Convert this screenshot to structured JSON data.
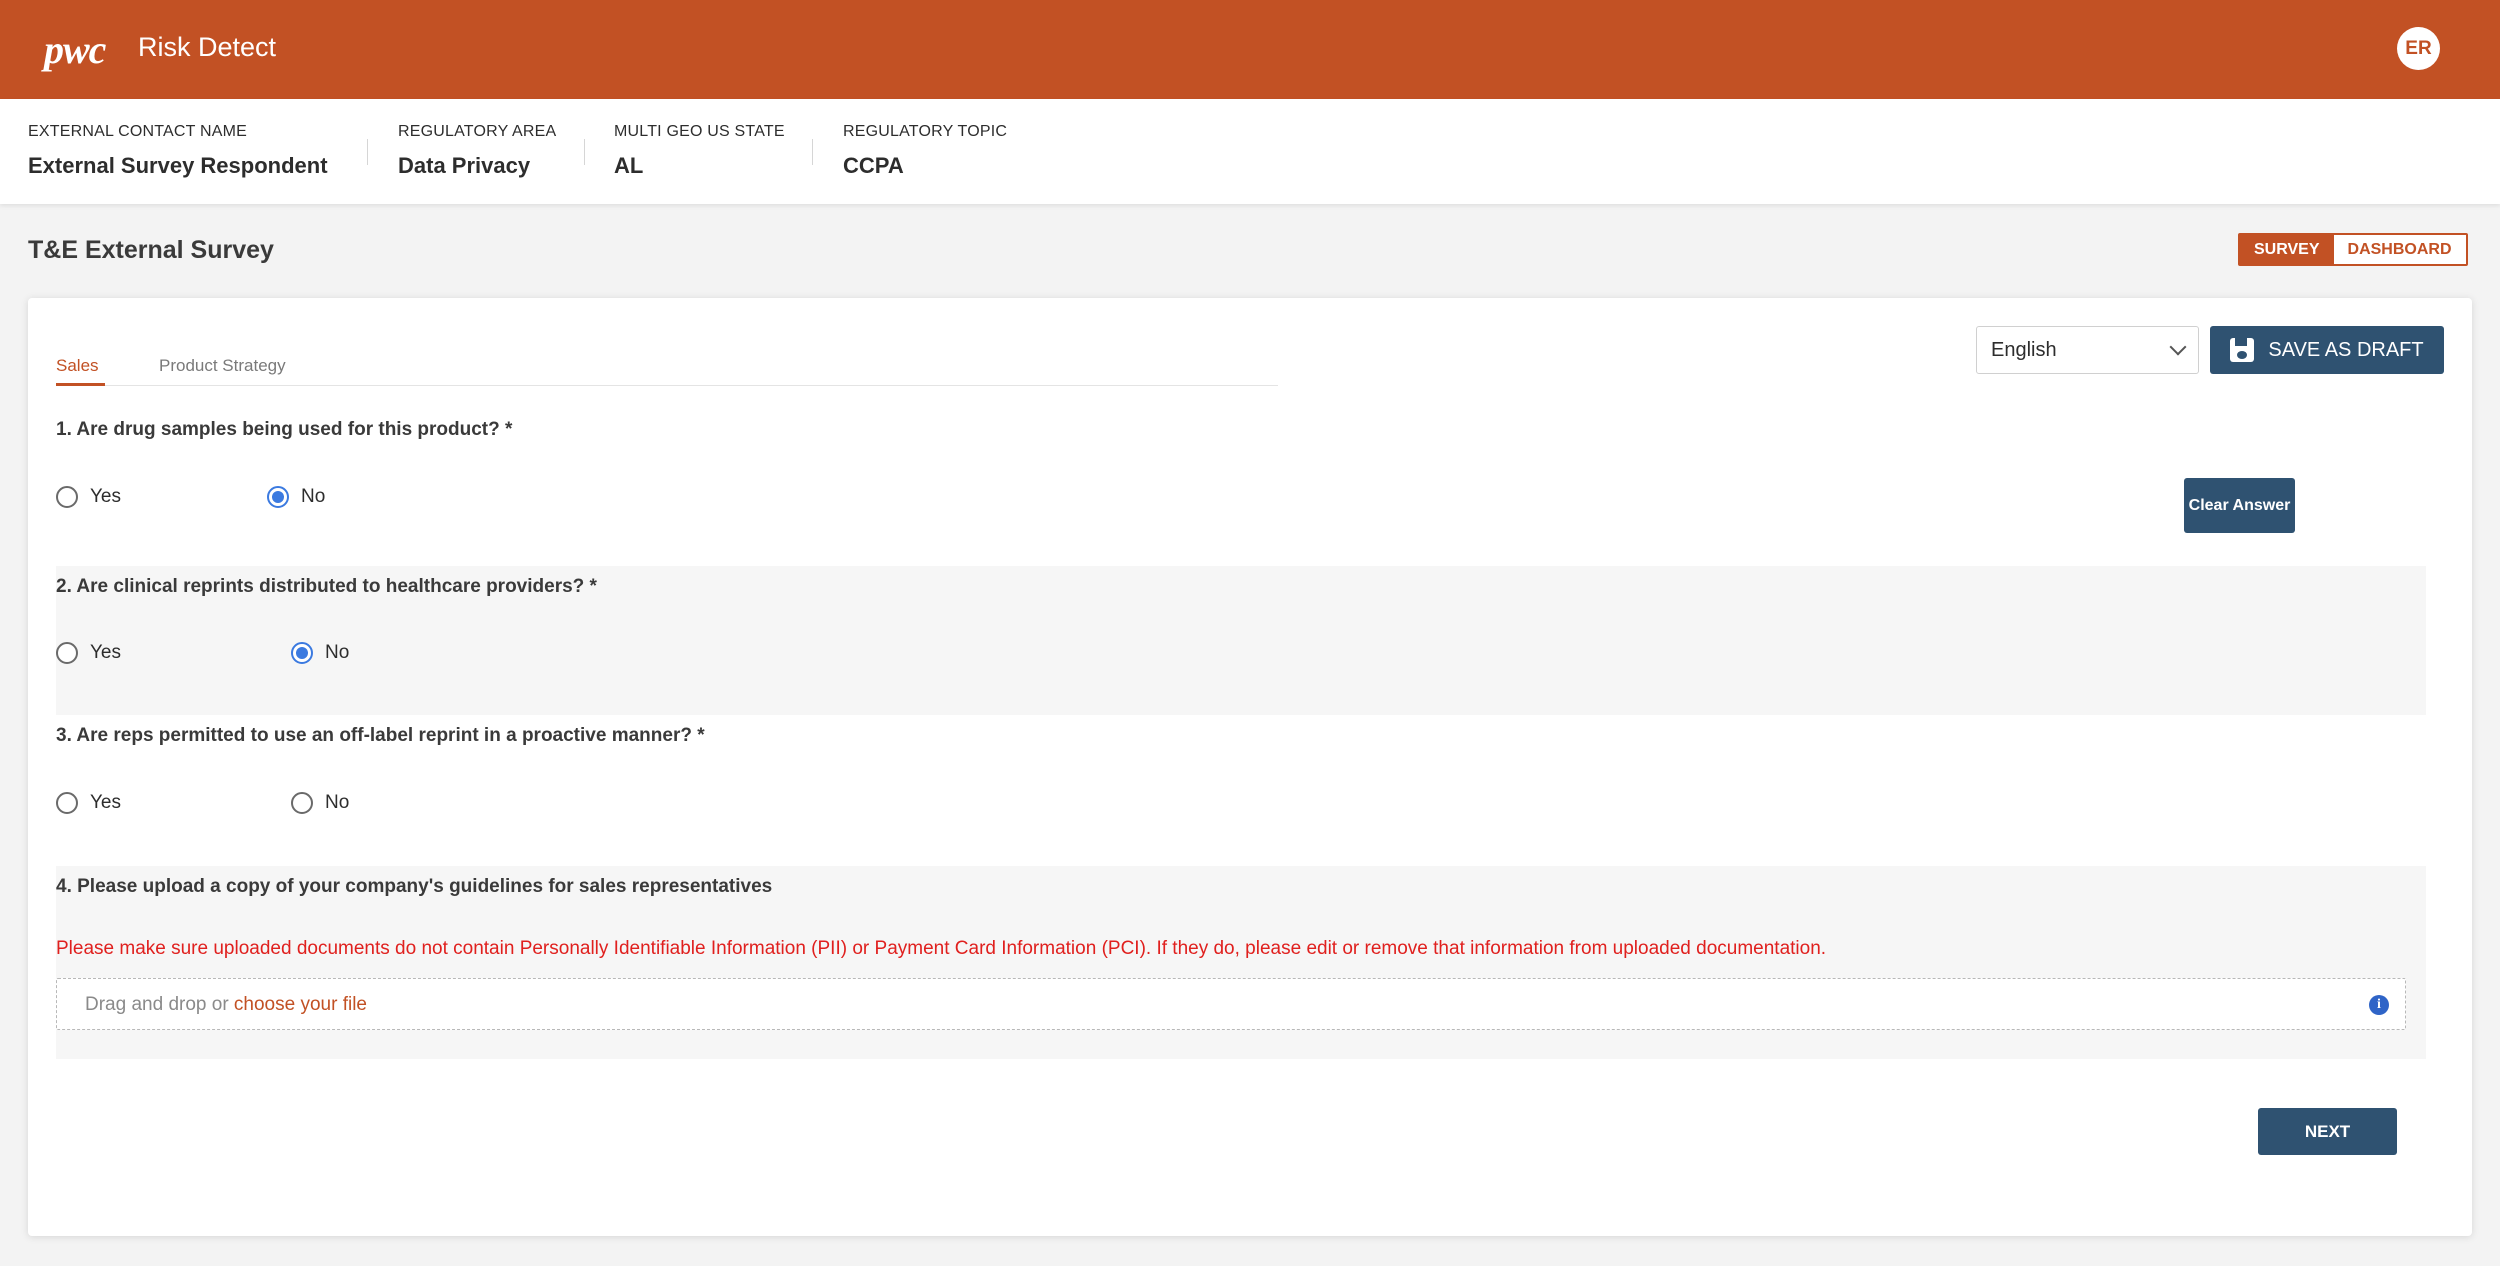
{
  "header": {
    "logo": "pwc",
    "app_title": "Risk Detect",
    "avatar_initials": "ER"
  },
  "info": [
    {
      "label": "EXTERNAL CONTACT NAME",
      "value": "External Survey Respondent"
    },
    {
      "label": "REGULATORY AREA",
      "value": "Data Privacy"
    },
    {
      "label": "MULTI GEO US STATE",
      "value": "AL"
    },
    {
      "label": "REGULATORY TOPIC",
      "value": "CCPA"
    }
  ],
  "page": {
    "title": "T&E External Survey",
    "toggle": {
      "survey": "SURVEY",
      "dashboard": "DASHBOARD",
      "active": "survey"
    }
  },
  "tabs": [
    {
      "label": "Sales",
      "active": true
    },
    {
      "label": "Product Strategy",
      "active": false
    }
  ],
  "language": {
    "selected": "English"
  },
  "actions": {
    "save_draft": "SAVE AS DRAFT",
    "clear_answer": "Clear Answer",
    "next": "NEXT"
  },
  "questions": [
    {
      "text": "1. Are drug samples being used for this product? *",
      "options": [
        "Yes",
        "No"
      ],
      "selected": "No"
    },
    {
      "text": "2. Are clinical reprints distributed to healthcare providers? *",
      "options": [
        "Yes",
        "No"
      ],
      "selected": "No"
    },
    {
      "text": "3. Are reps permitted to use an off-label reprint in a proactive manner? *",
      "options": [
        "Yes",
        "No"
      ],
      "selected": null
    },
    {
      "text": "4. Please upload a copy of your company's guidelines for sales representatives"
    }
  ],
  "upload": {
    "warning": "Please make sure uploaded documents do not contain Personally Identifiable Information (PII) or Payment Card Information (PCI). If they do, please edit or remove that information from uploaded documentation.",
    "drop_text": "Drag and drop or ",
    "choose_link": "choose your file"
  },
  "colors": {
    "brand": "#c25124",
    "primary_button": "#2f5271",
    "warning": "#e0201e",
    "radio_selected": "#3b7ae0"
  }
}
